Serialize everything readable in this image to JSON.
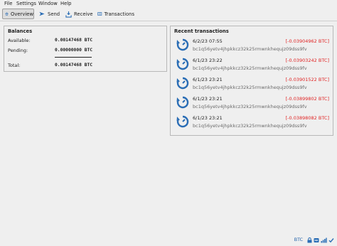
{
  "menu": {
    "file": "File",
    "settings": "Settings",
    "window": "Window",
    "help": "Help"
  },
  "tabs": {
    "overview": "Overview",
    "send": "Send",
    "receive": "Receive",
    "transactions": "Transactions"
  },
  "balances": {
    "title": "Balances",
    "available_label": "Available:",
    "available_value": "0.00147468 BTC",
    "pending_label": "Pending:",
    "pending_value": "0.00000000 BTC",
    "total_label": "Total:",
    "total_value": "0.00147468 BTC"
  },
  "recent": {
    "title": "Recent transactions",
    "items": [
      {
        "date": "6/2/23 07:55",
        "amount": "[-0.03904962 BTC]",
        "address": "bc1q56yetv4jhpkkcz32k25rmwnkhequjz09dss9fv"
      },
      {
        "date": "6/1/23 23:22",
        "amount": "[-0.03903242 BTC]",
        "address": "bc1q56yetv4jhpkkcz32k25rmwnkhequjz09dss9fv"
      },
      {
        "date": "6/1/23 23:21",
        "amount": "[-0.03901522 BTC]",
        "address": "bc1q56yetv4jhpkkcz32k25rmwnkhequjz09dss9fv"
      },
      {
        "date": "6/1/23 23:21",
        "amount": "[-0.03899802 BTC]",
        "address": "bc1q56yetv4jhpkkcz32k25rmwnkhequjz09dss9fv"
      },
      {
        "date": "6/1/23 23:21",
        "amount": "[-0.03898082 BTC]",
        "address": "bc1q56yetv4jhpkkcz32k25rmwnkhequjz09dss9fv"
      }
    ]
  },
  "status": {
    "unit": "BTC",
    "icons": [
      "lock-icon",
      "hd-icon",
      "network-icon",
      "sync-check-icon"
    ]
  },
  "colors": {
    "negative_amount": "#e02424",
    "tx_icon": "#2a6db5",
    "unit_link": "#1f5fa8"
  }
}
